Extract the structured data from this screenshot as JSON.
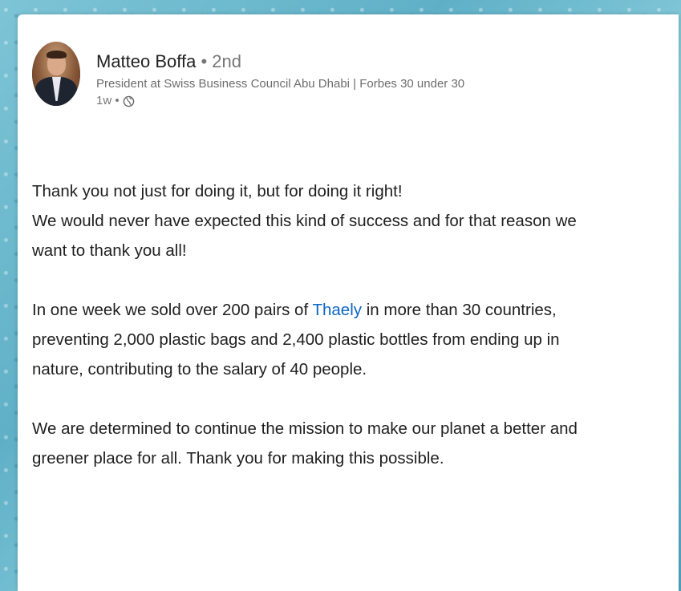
{
  "post": {
    "author": {
      "name": "Matteo Boffa",
      "separator": " • ",
      "degree": "2nd",
      "headline": "President at Swiss Business Council Abu Dhabi | Forbes 30 under 30",
      "time": "1w •",
      "visibility_icon": "globe-icon"
    },
    "body": {
      "line1": "Thank you not just for doing it, but for doing it right!",
      "line2": "We would never have expected this kind of success and for that reason we",
      "line3": "want to thank you all!",
      "p2_part1": "In one week we sold over 200 pairs of ",
      "p2_mention": "Thaely",
      "p2_part2": " in more than 30 countries,",
      "p2_line2": "preventing 2,000 plastic bags and 2,400 plastic bottles from ending up in",
      "p2_line3": "nature, contributing to the salary of 40 people.",
      "p3_line1": "We are determined to continue the mission to make our planet a better and",
      "p3_line2": "greener place for all. Thank you for making this possible."
    }
  },
  "colors": {
    "mention": "#0a66c2",
    "background": "#6fb9cf"
  }
}
